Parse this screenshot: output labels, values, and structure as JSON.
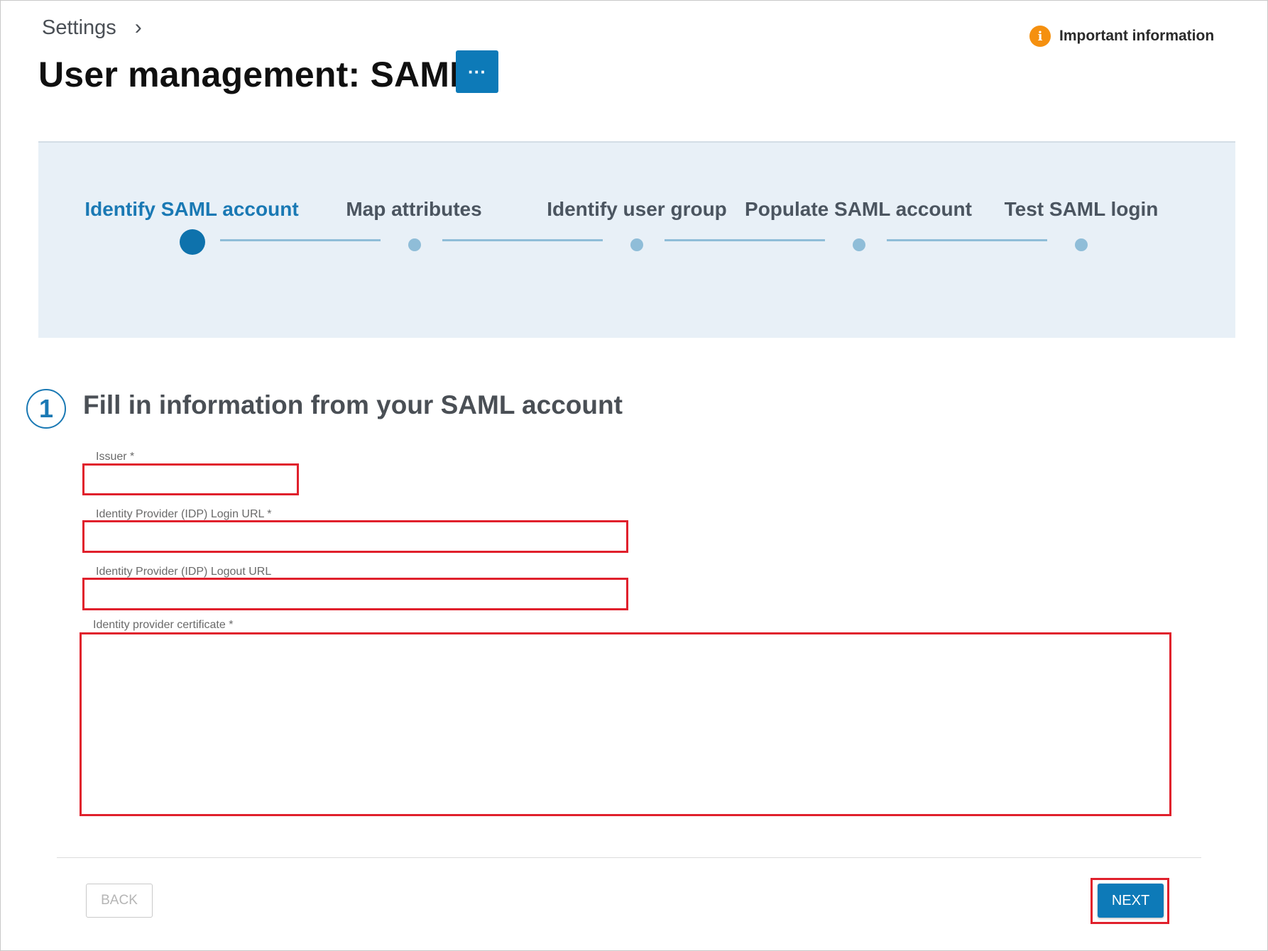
{
  "breadcrumb": {
    "settings": "Settings",
    "separator_icon": "chevron-right-icon"
  },
  "header": {
    "title": "User management: SAML",
    "more_label": "···",
    "accent": "#0d7ab8"
  },
  "important_info": {
    "icon_glyph": "i",
    "label": "Important information",
    "icon_color": "#f5900f"
  },
  "stepper": {
    "steps": [
      {
        "label": "Identify SAML account",
        "active": true
      },
      {
        "label": "Map attributes",
        "active": false
      },
      {
        "label": "Identify user group",
        "active": false
      },
      {
        "label": "Populate SAML account",
        "active": false
      },
      {
        "label": "Test SAML login",
        "active": false
      }
    ]
  },
  "section": {
    "number": "1",
    "title": "Fill in information from your SAML account"
  },
  "form": {
    "issuer": {
      "label": "Issuer *",
      "value": ""
    },
    "login_url": {
      "label": "Identity Provider (IDP) Login URL *",
      "value": ""
    },
    "logout_url": {
      "label": "Identity Provider (IDP) Logout URL",
      "value": ""
    },
    "certificate": {
      "label": "Identity provider certificate *",
      "value": ""
    }
  },
  "footer": {
    "back_label": "BACK",
    "next_label": "NEXT"
  }
}
